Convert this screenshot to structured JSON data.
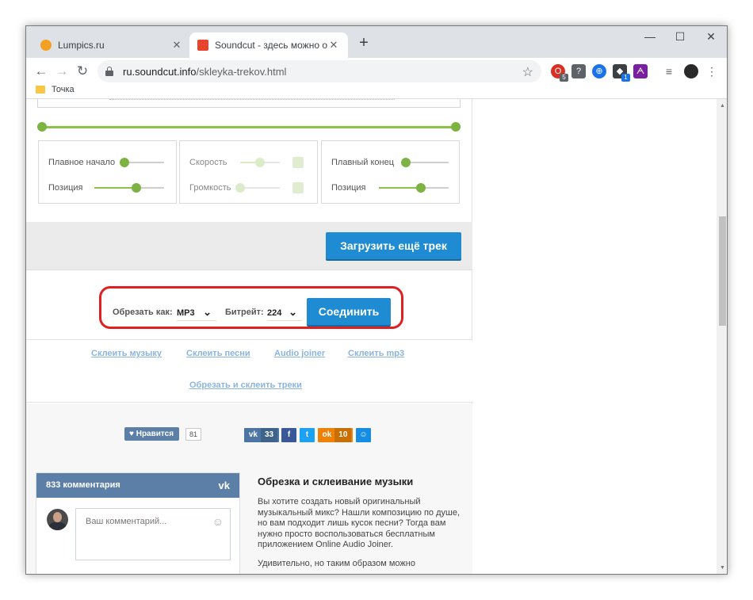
{
  "browser": {
    "tabs": [
      {
        "label": "Lumpics.ru",
        "favicon_color": "#f4a024"
      },
      {
        "label": "Soundcut - здесь можно обреза",
        "favicon_color": "#e8432c"
      }
    ],
    "address": {
      "host": "ru.soundcut.info",
      "path": "/skleyka-trekov.html"
    },
    "bookmark": "Точка",
    "extensions": [
      {
        "icon": "opera-icon",
        "badge": "5",
        "color": "#d93025"
      },
      {
        "icon": "help-icon",
        "color": "#5f6368"
      },
      {
        "icon": "vpn-globe-icon",
        "color": "#1a73e8"
      },
      {
        "icon": "cube-icon",
        "badge": "1",
        "color": "#3c4043"
      },
      {
        "icon": "extension-icon",
        "color": "#7b1fa2"
      },
      {
        "icon": "playlist-icon",
        "color": "#5f6368"
      }
    ]
  },
  "controls": {
    "box1": {
      "row1_label": "Плавное начало",
      "row2_label": "Позиция"
    },
    "box2": {
      "row1_label": "Скорость",
      "row2_label": "Громкость"
    },
    "box3": {
      "row1_label": "Плавный конец",
      "row2_label": "Позиция"
    },
    "levels": {
      "fade_in": 0.0,
      "position1": 0.6,
      "speed": 0.5,
      "volume": 0.0,
      "fade_out": 0.0,
      "position3": 0.6
    }
  },
  "upload_button": "Загрузить ещё трек",
  "join": {
    "format_label": "Обрезать как:",
    "format_value": "MP3",
    "bitrate_label": "Битрейт:",
    "bitrate_value": "224",
    "button": "Соединить"
  },
  "links": [
    "Склеить музыку",
    "Склеить песни",
    "Audio joiner",
    "Склеить mp3",
    "Обрезать и склеить треки"
  ],
  "social": {
    "like_label": "Нравится",
    "like_count": "81",
    "vk_count": "33",
    "ok_count": "10"
  },
  "comments": {
    "header": "833 комментария",
    "placeholder": "Ваш комментарий..."
  },
  "article": {
    "title": "Обрезка и склеивание музыки",
    "p1": "Вы хотите создать новый оригинальный музыкальный микс? Нашли композицию по душе, но вам подходит лишь кусок песни? Тогда вам нужно просто воспользоваться бесплатным приложением Online Audio Joiner.",
    "p2": "Удивительно, но таким образом можно"
  }
}
